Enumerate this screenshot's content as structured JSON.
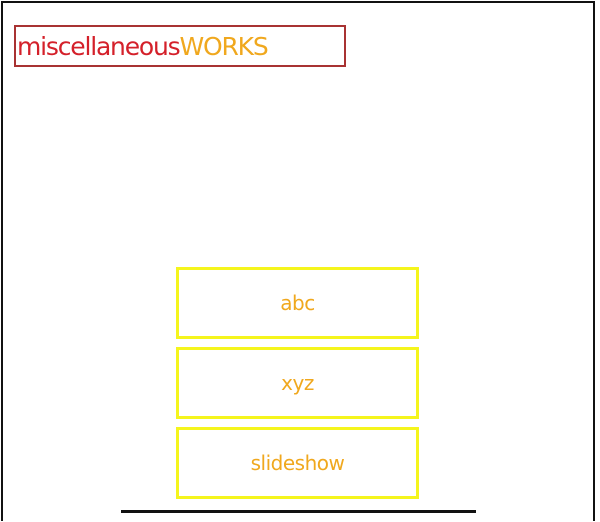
{
  "logo": {
    "part1": "miscellaneous",
    "part2": "WORKS",
    "colors": {
      "part1": "#d4202a",
      "part2": "#f0a81e",
      "border": "#a83232"
    }
  },
  "nav": {
    "items": [
      {
        "label": "abc"
      },
      {
        "label": "xyz"
      },
      {
        "label": "slideshow"
      }
    ],
    "colors": {
      "text": "#f0a81e",
      "border": "#f5f51c"
    }
  }
}
